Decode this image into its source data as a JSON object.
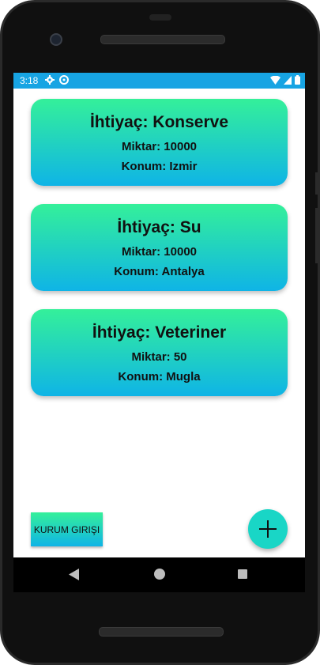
{
  "status_bar": {
    "time": "3:18",
    "background": "#17a4e3",
    "icons_left": [
      "gear-icon",
      "sync-icon"
    ],
    "icons_right": [
      "wifi-icon",
      "signal-icon",
      "battery-icon"
    ]
  },
  "cards": [
    {
      "title": "İhtiyaç: Konserve",
      "amount": "Miktar: 10000",
      "location": "Konum: Izmir"
    },
    {
      "title": "İhtiyaç: Su",
      "amount": "Miktar: 10000",
      "location": "Konum: Antalya"
    },
    {
      "title": "İhtiyaç: Veteriner",
      "amount": "Miktar: 50",
      "location": "Konum: Mugla"
    }
  ],
  "buttons": {
    "institution_login": "KURUM GIRIŞI",
    "add_icon": "plus-icon"
  },
  "colors": {
    "card_gradient_top": "#34f09a",
    "card_gradient_bottom": "#0fb4e6",
    "fab": "#19d6c6"
  },
  "nav_bar": {
    "icons": [
      "back-icon",
      "home-icon",
      "recents-icon"
    ]
  }
}
